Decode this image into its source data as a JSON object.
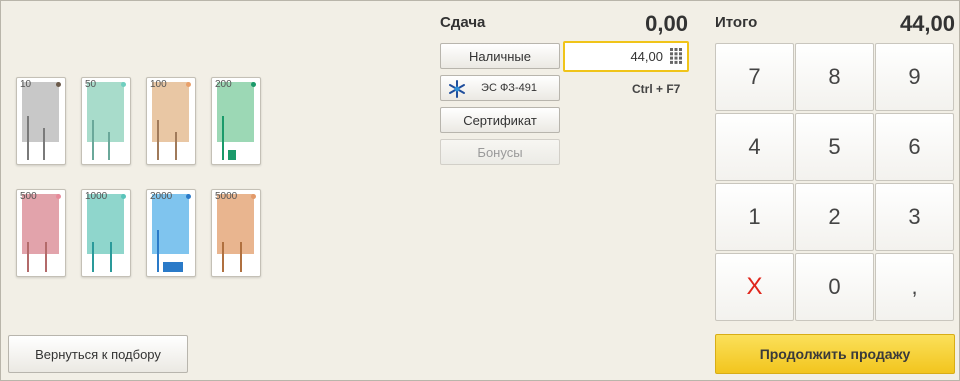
{
  "banknotes": [
    {
      "label": "10",
      "face": "#c8c8c8",
      "dot": "#6b5a4a",
      "leg": "#7a7a7a"
    },
    {
      "label": "50",
      "face": "#a8dccb",
      "dot": "#6fcfc0",
      "leg": "#6aa89a"
    },
    {
      "label": "100",
      "face": "#e9c7a4",
      "dot": "#e9a06a",
      "leg": "#a07a5a"
    },
    {
      "label": "200",
      "face": "#9cd8b5",
      "dot": "#1a9a6a",
      "leg": "#1a9a6a"
    },
    {
      "label": "500",
      "face": "#e2a3ab",
      "dot": "#e78a9a",
      "leg": "#b36a6a"
    },
    {
      "label": "1000",
      "face": "#8fd6cc",
      "dot": "#5ac4bb",
      "leg": "#2a9a9a"
    },
    {
      "label": "2000",
      "face": "#7fc4ee",
      "dot": "#2a7ac8",
      "leg": "#2a7ac8"
    },
    {
      "label": "5000",
      "face": "#e9b58f",
      "dot": "#e39a6a",
      "leg": "#b0703f"
    }
  ],
  "change": {
    "label": "Сдача",
    "value": "0,00"
  },
  "total": {
    "label": "Итого",
    "value": "44,00"
  },
  "payment": {
    "cash_label": "Наличные",
    "cash_value": "44,00",
    "card_label": "ЭС ФЗ-491",
    "card_shortcut": "Ctrl + F7",
    "certificate_label": "Сертификат",
    "bonus_label": "Бонусы"
  },
  "keypad": [
    "7",
    "8",
    "9",
    "4",
    "5",
    "6",
    "1",
    "2",
    "3",
    "X",
    "0",
    ","
  ],
  "actions": {
    "back_label": "Вернуться к подбору",
    "continue_label": "Продолжить продажу"
  },
  "colors": {
    "accent": "#f0c419",
    "clear_key": "#e0261c"
  }
}
